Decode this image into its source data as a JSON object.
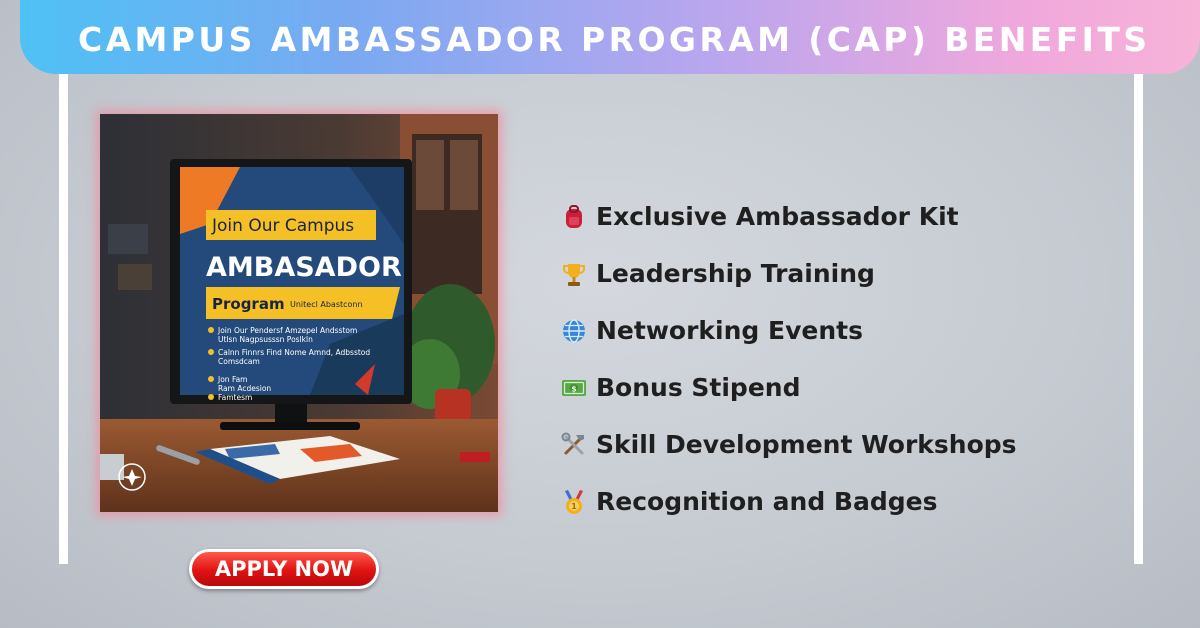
{
  "header": {
    "title": "CAMPUS AMBASSADOR PROGRAM (CAP) BENEFITS"
  },
  "poster": {
    "line1": "Join Our Campus",
    "line2": "AMBASADOR",
    "line3": "Program",
    "line3_small": "Unitecl Abastconn",
    "bullets": [
      "Join Our Pendersf Amzepel Andsstom",
      "Utlsn Nagpsusssn Poslkln",
      "Calnn Finnrs Find Nome Amnd, Adbsstod",
      "Comsdcam",
      "Jon Fam",
      "Ram Acdesion",
      "Famtesm"
    ]
  },
  "benefits": [
    {
      "icon": "backpack-icon",
      "label": "Exclusive Ambassador Kit"
    },
    {
      "icon": "trophy-icon",
      "label": "Leadership Training"
    },
    {
      "icon": "globe-icon",
      "label": "Networking Events"
    },
    {
      "icon": "money-icon",
      "label": "Bonus Stipend"
    },
    {
      "icon": "tools-icon",
      "label": "Skill Development Workshops"
    },
    {
      "icon": "medal-icon",
      "label": "Recognition and Badges"
    }
  ],
  "cta": {
    "label": "APPLY NOW"
  },
  "colors": {
    "banner_start": "#4ec1f5",
    "banner_end": "#f7b3d8",
    "button_red": "#e01212",
    "text_dark": "#1f1f1f",
    "poster_glow": "#ff788c"
  }
}
